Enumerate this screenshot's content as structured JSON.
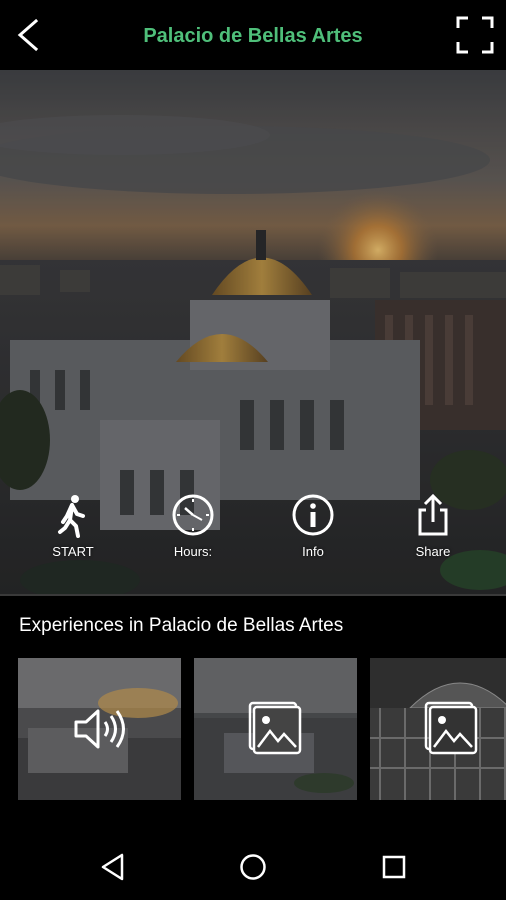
{
  "header": {
    "title": "Palacio de Bellas Artes",
    "icons": {
      "back": "back-arrow-icon",
      "fullscreen": "fullscreen-icon"
    }
  },
  "actions": [
    {
      "label": "START",
      "icon": "walking-person-icon"
    },
    {
      "label": "Hours:",
      "icon": "clock-icon"
    },
    {
      "label": "Info",
      "icon": "info-icon"
    },
    {
      "label": "Share",
      "icon": "share-icon"
    }
  ],
  "experiences": {
    "title": "Experiences in Palacio de Bellas Artes",
    "items": [
      {
        "type": "audio",
        "icon": "speaker-icon"
      },
      {
        "type": "gallery",
        "icon": "image-gallery-icon"
      },
      {
        "type": "gallery",
        "icon": "image-gallery-icon"
      }
    ]
  },
  "navbar": {
    "icons": [
      "nav-back-icon",
      "nav-home-icon",
      "nav-recents-icon"
    ]
  },
  "colors": {
    "title": "#4fbf7a",
    "background": "#000000"
  }
}
